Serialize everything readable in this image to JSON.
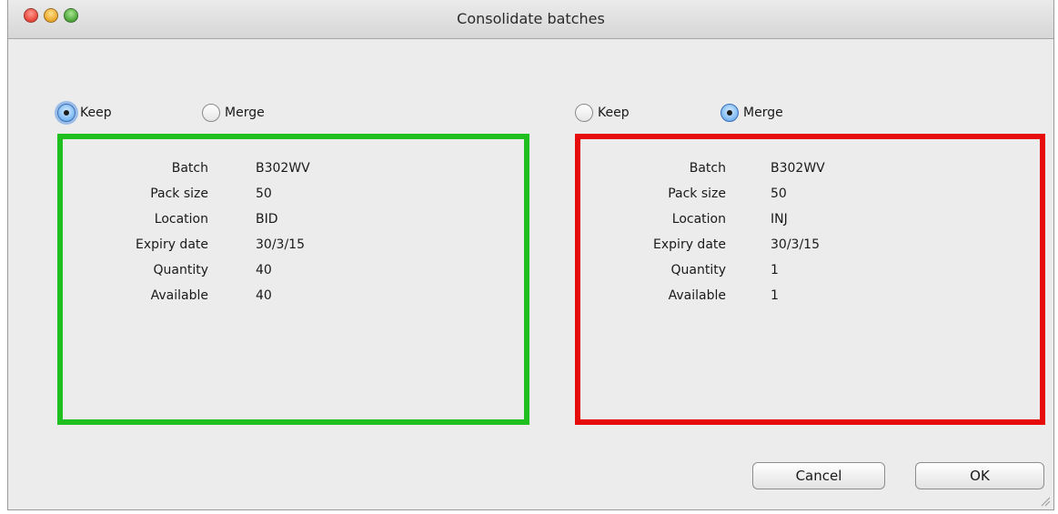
{
  "window": {
    "title": "Consolidate batches"
  },
  "left": {
    "options": [
      {
        "label": "Keep",
        "checked": true
      },
      {
        "label": "Merge",
        "checked": false
      }
    ],
    "border_color": "#1fbf1f",
    "fields": [
      {
        "label": "Batch",
        "value": "B302WV"
      },
      {
        "label": "Pack size",
        "value": "50"
      },
      {
        "label": "Location",
        "value": "BID"
      },
      {
        "label": "Expiry date",
        "value": "30/3/15"
      },
      {
        "label": "Quantity",
        "value": "40"
      },
      {
        "label": "Available",
        "value": "40"
      }
    ]
  },
  "right": {
    "options": [
      {
        "label": "Keep",
        "checked": false
      },
      {
        "label": "Merge",
        "checked": true
      }
    ],
    "border_color": "#e60c0c",
    "fields": [
      {
        "label": "Batch",
        "value": "B302WV"
      },
      {
        "label": "Pack size",
        "value": "50"
      },
      {
        "label": "Location",
        "value": "INJ"
      },
      {
        "label": "Expiry date",
        "value": "30/3/15"
      },
      {
        "label": "Quantity",
        "value": "1"
      },
      {
        "label": "Available",
        "value": "1"
      }
    ]
  },
  "buttons": {
    "cancel_label": "Cancel",
    "ok_label": "OK"
  }
}
